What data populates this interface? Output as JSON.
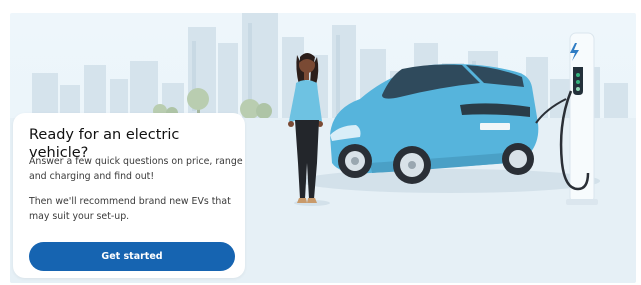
{
  "banner": {
    "title": "Ready for an electric vehicle?",
    "paragraph1": "Answer a few quick questions on price, range and charging and find out!",
    "paragraph2": "Then we'll recommend brand new EVs that may suit your set-up.",
    "cta_label": "Get started"
  },
  "illustration": {
    "elements": [
      "city-skyline",
      "trees",
      "woman-figure",
      "blue-electric-car",
      "ev-charging-station",
      "lightning-bolt-icon"
    ]
  },
  "colors": {
    "cta_background": "#1664b1",
    "cta_text": "#ffffff",
    "scene_background": "#eaf4fa",
    "car_body": "#56b4dc",
    "card_background": "#ffffff"
  }
}
